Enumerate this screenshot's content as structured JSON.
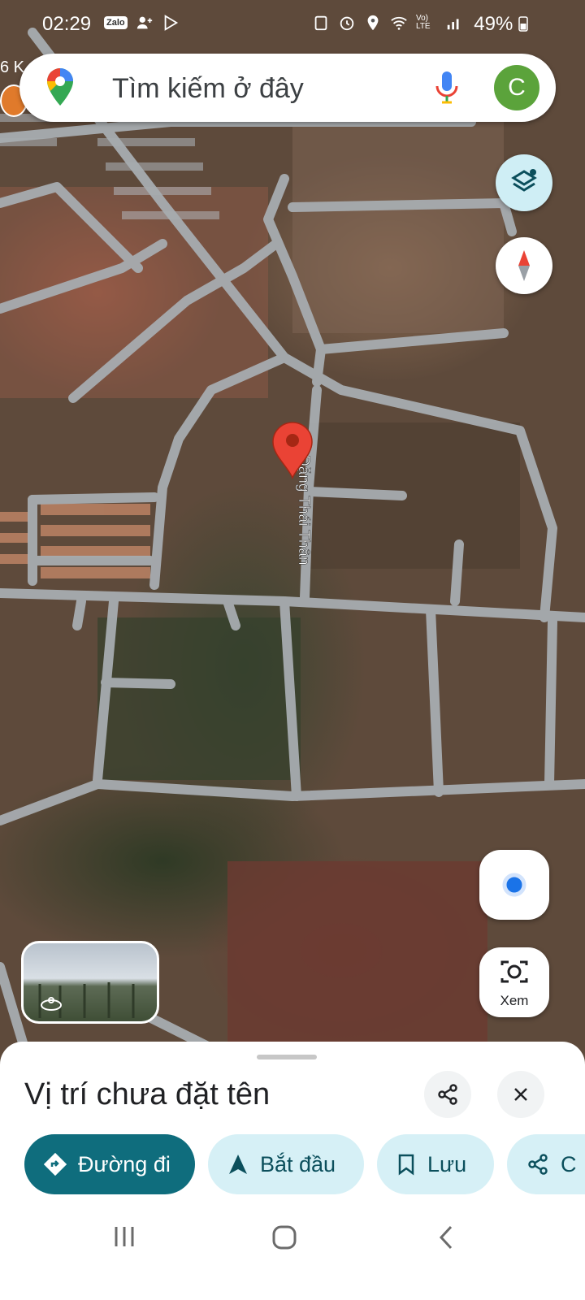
{
  "status_bar": {
    "time": "02:29",
    "left_icons": [
      "zalo-icon",
      "person-add-icon",
      "play-store-icon"
    ],
    "right_icons": [
      "recycle-icon",
      "alarm-icon",
      "location-icon",
      "wifi-icon",
      "volte-icon",
      "signal-icon"
    ],
    "volte_label": "Vo) LTE",
    "battery": "49%"
  },
  "search": {
    "placeholder": "Tìm kiếm ở đây",
    "avatar_letter": "C"
  },
  "map": {
    "poi_distance": "6 K",
    "street_label": "Đặng Thái Thân",
    "pin_color": "#ea4335"
  },
  "controls": {
    "lens_label": "Xem"
  },
  "sheet": {
    "title": "Vị trí chưa đặt tên",
    "actions": {
      "directions": "Đường đi",
      "start": "Bắt đầu",
      "save": "Lưu",
      "share": "C"
    }
  },
  "colors": {
    "primary_pill": "#0f6d7d",
    "secondary_pill": "#d6f0f6",
    "avatar": "#5ba33b"
  }
}
